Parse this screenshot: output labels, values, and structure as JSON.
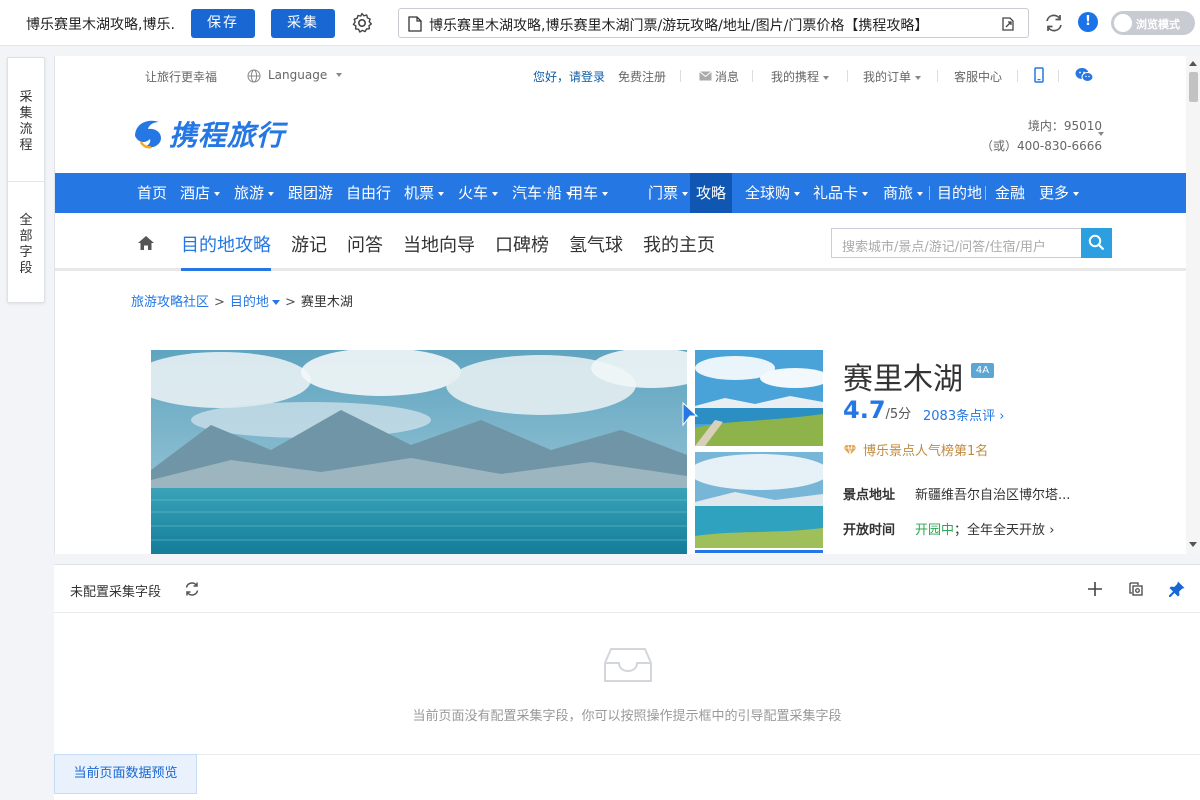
{
  "toolbar": {
    "tab_title": "博乐赛里木湖攻略,博乐...",
    "save_label": "保存",
    "collect_label": "采集",
    "url": "博乐赛里木湖攻略,博乐赛里木湖门票/游玩攻略/地址/图片/门票价格【携程攻略】",
    "alert_label": "!",
    "browse_mode_label": "浏览模式"
  },
  "side_tabs": {
    "flow": "采集流程",
    "all_fields": "全部字段"
  },
  "site": {
    "topbar": {
      "slogan": "让旅行更幸福",
      "language": "Language",
      "greeting": "您好，请登录",
      "register": "免费注册",
      "messages": "消息",
      "my_trip": "我的携程",
      "my_orders": "我的订单",
      "service": "客服中心"
    },
    "logo_text": "携程旅行",
    "hotline": {
      "domestic": "境内：95010",
      "alt": "（或）400-830-6666"
    },
    "main_nav": [
      {
        "label": "首页",
        "caret": false
      },
      {
        "label": "酒店",
        "caret": true
      },
      {
        "label": "旅游",
        "caret": true
      },
      {
        "label": "跟团游",
        "caret": false
      },
      {
        "label": "自由行",
        "caret": false
      },
      {
        "label": "机票",
        "caret": true
      },
      {
        "label": "火车",
        "caret": true
      },
      {
        "label": "汽车·船",
        "caret": true
      },
      {
        "label": "用车",
        "caret": true
      },
      {
        "label": "门票",
        "caret": true
      },
      {
        "label": "攻略",
        "caret": false,
        "active": true
      },
      {
        "label": "全球购",
        "caret": true
      },
      {
        "label": "礼品卡",
        "caret": true
      },
      {
        "label": "商旅",
        "caret": true
      },
      {
        "label": "目的地",
        "caret": false
      },
      {
        "label": "金融",
        "caret": false
      },
      {
        "label": "更多",
        "caret": true
      }
    ],
    "sub_nav": [
      "目的地攻略",
      "游记",
      "问答",
      "当地向导",
      "口碑榜",
      "氢气球",
      "我的主页"
    ],
    "search_placeholder": "搜索城市/景点/游记/问答/住宿/用户",
    "breadcrumb": [
      "旅游攻略社区",
      "目的地",
      "赛里木湖"
    ],
    "attraction": {
      "name": "赛里木湖",
      "level": "4A",
      "score": "4.7",
      "score_out_of": "/5分",
      "reviews": "2083条点评",
      "rank": "博乐景点人气榜第1名",
      "address_label": "景点地址",
      "address": "新疆维吾尔自治区博尔塔...",
      "hours_label": "开放时间",
      "hours_status": "开园中",
      "hours_sep": "；",
      "hours": "全年全天开放"
    }
  },
  "panel": {
    "title": "未配置采集字段",
    "empty_message": "当前页面没有配置采集字段，你可以按照操作提示框中的引导配置采集字段",
    "preview_label": "当前页面数据预览"
  },
  "colors": {
    "primary": "#1967d2",
    "ctrip_blue": "#2577e3",
    "nav_active": "#1056b3",
    "open_green": "#2aa94f",
    "rank_gold": "#c08a3e"
  }
}
